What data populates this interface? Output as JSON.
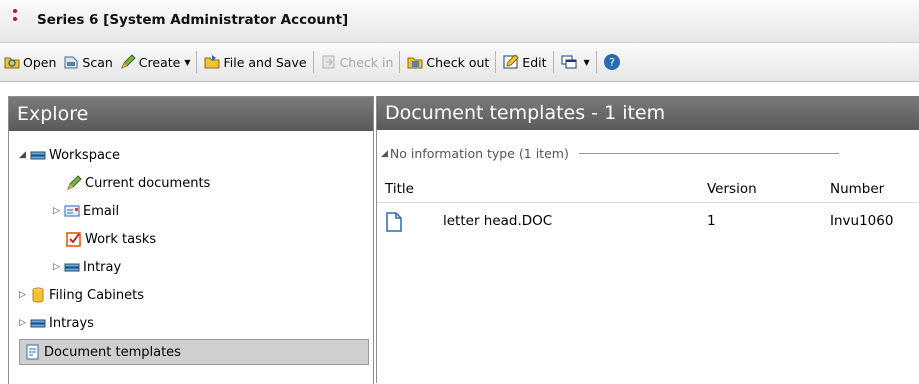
{
  "window": {
    "title": "Series 6 [System Administrator Account]"
  },
  "toolbar": {
    "open": "Open",
    "scan": "Scan",
    "create": "Create",
    "file_and_save": "File and Save",
    "check_in": "Check in",
    "check_out": "Check out",
    "edit": "Edit"
  },
  "explore": {
    "header": "Explore",
    "items": [
      {
        "label": "Workspace"
      },
      {
        "label": "Current documents"
      },
      {
        "label": "Email"
      },
      {
        "label": "Work tasks"
      },
      {
        "label": "Intray"
      },
      {
        "label": "Filing Cabinets"
      },
      {
        "label": "Intrays"
      },
      {
        "label": "Document templates"
      }
    ]
  },
  "content": {
    "header": "Document templates - 1 item",
    "group": "No information type (1 item)",
    "columns": {
      "title": "Title",
      "version": "Version",
      "number": "Number"
    },
    "rows": [
      {
        "title": "letter head.DOC",
        "version": "1",
        "number": "Invu1060"
      }
    ]
  }
}
